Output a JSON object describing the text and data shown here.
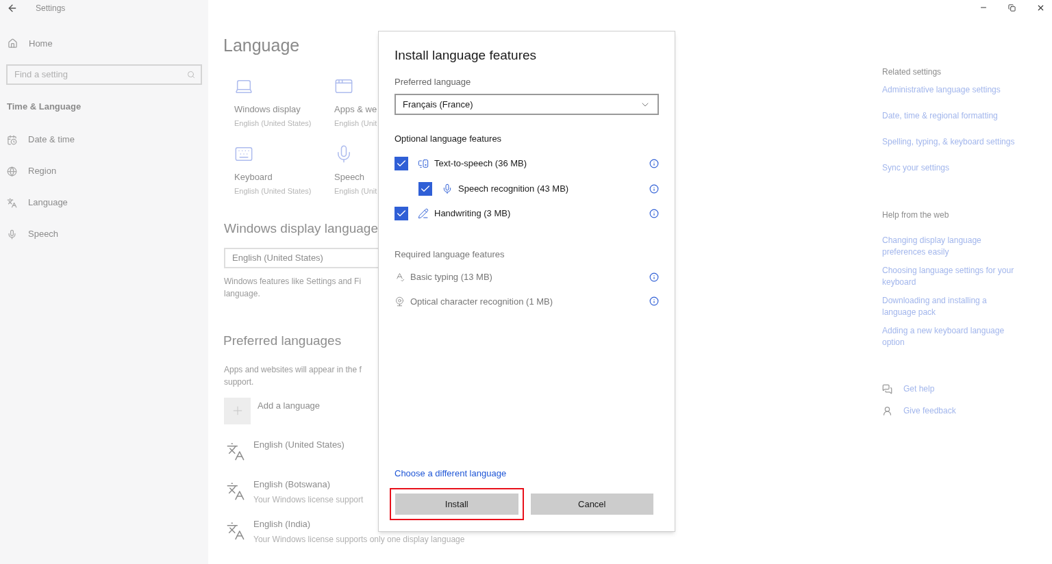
{
  "window": {
    "title": "Settings"
  },
  "sidebar": {
    "home": "Home",
    "search": {
      "placeholder": "Find a setting"
    },
    "section": "Time & Language",
    "items": [
      {
        "label": "Date & time"
      },
      {
        "label": "Region"
      },
      {
        "label": "Language"
      },
      {
        "label": "Speech"
      }
    ]
  },
  "main": {
    "title": "Language",
    "tiles": [
      {
        "label": "Windows display",
        "sublabel": "English (United States)"
      },
      {
        "label": "Apps & we",
        "sublabel": "English (Unit"
      },
      {
        "label": "Keyboard",
        "sublabel": "English (United States)"
      },
      {
        "label": "Speech",
        "sublabel": "English (Unit"
      }
    ],
    "display_heading": "Windows display language",
    "display_value": "English (United States)",
    "display_description": "Windows features like Settings and Fi",
    "display_description_2": "language.",
    "preferred_heading": "Preferred languages",
    "preferred_description": "Apps and websites will appear in the f",
    "preferred_description_2": "support.",
    "add_language": "Add a language",
    "languages": [
      {
        "name": "English (United States)"
      },
      {
        "name": "English (Botswana)",
        "note": "Your Windows license support"
      },
      {
        "name": "English (India)",
        "note": "Your Windows license supports only one display language"
      }
    ]
  },
  "dialog": {
    "title": "Install language features",
    "preferred_label": "Preferred language",
    "preferred_value": "Français (France)",
    "optional_heading": "Optional language features",
    "optional_features": [
      {
        "label": "Text-to-speech (36 MB)",
        "checked": true,
        "children": [
          {
            "label": "Speech recognition (43 MB)",
            "checked": true
          }
        ]
      },
      {
        "label": "Handwriting (3 MB)",
        "checked": true
      }
    ],
    "required_heading": "Required language features",
    "required_features": [
      {
        "label": "Basic typing (13 MB)"
      },
      {
        "label": "Optical character recognition (1 MB)"
      }
    ],
    "link": "Choose a different language",
    "buttons": [
      {
        "label": "Install",
        "highlighted": true
      },
      {
        "label": "Cancel",
        "highlighted": false
      }
    ]
  },
  "related": {
    "heading": "Related settings",
    "links": [
      "Administrative language settings",
      "Date, time & regional formatting",
      "Spelling, typing, & keyboard settings",
      "Sync your settings"
    ]
  },
  "help": {
    "heading": "Help from the web",
    "links": [
      "Changing display language preferences easily",
      "Choosing language settings for your keyboard",
      "Downloading and installing a language pack",
      "Adding a new keyboard language option"
    ]
  },
  "actions": [
    {
      "label": "Get help"
    },
    {
      "label": "Give feedback"
    }
  ]
}
